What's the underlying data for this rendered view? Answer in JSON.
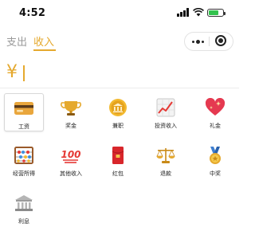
{
  "status_bar": {
    "time": "4:52"
  },
  "tabs": [
    {
      "label": "支出",
      "active": false
    },
    {
      "label": "收入",
      "active": true
    }
  ],
  "amount": {
    "currency_symbol": "¥",
    "value": ""
  },
  "categories": [
    {
      "label": "工资",
      "icon": "credit-card-icon",
      "selected": true
    },
    {
      "label": "奖金",
      "icon": "trophy-icon",
      "selected": false
    },
    {
      "label": "兼职",
      "icon": "bank-coin-icon",
      "selected": false
    },
    {
      "label": "投资收入",
      "icon": "chart-increasing-icon",
      "selected": false
    },
    {
      "label": "礼金",
      "icon": "sparkling-heart-icon",
      "selected": false
    },
    {
      "label": "经营所得",
      "icon": "abacus-icon",
      "selected": false
    },
    {
      "label": "其他收入",
      "icon": "hundred-points-icon",
      "selected": false
    },
    {
      "label": "红包",
      "icon": "red-envelope-icon",
      "selected": false
    },
    {
      "label": "退款",
      "icon": "balance-scale-icon",
      "selected": false
    },
    {
      "label": "中奖",
      "icon": "medal-icon",
      "selected": false
    },
    {
      "label": "利息",
      "icon": "bank-building-icon",
      "selected": false
    }
  ],
  "colors": {
    "accent": "#e5a92e",
    "inactive_tab": "#9a9a9a"
  }
}
